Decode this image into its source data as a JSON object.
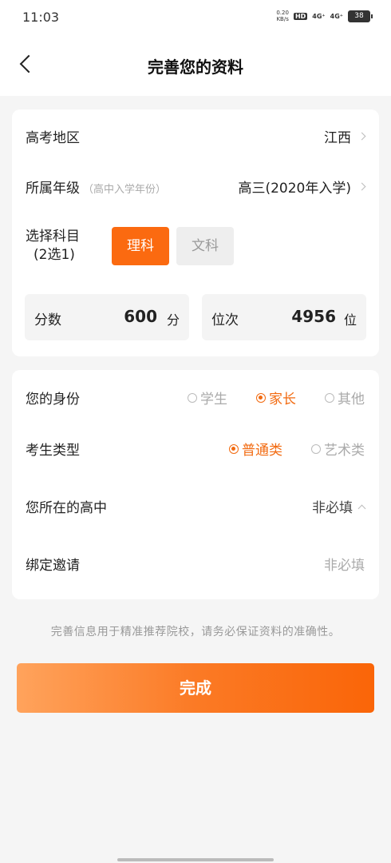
{
  "status_bar": {
    "time": "11:03",
    "net_speed_value": "0.20",
    "net_speed_unit": "KB/s",
    "hd": "HD",
    "signal1": "4G⁺",
    "signal2": "4G⁺",
    "battery": "38"
  },
  "header": {
    "title": "完善您的资料"
  },
  "card1": {
    "region": {
      "label": "高考地区",
      "value": "江西"
    },
    "grade": {
      "label": "所属年级",
      "sublabel": "（高中入学年份）",
      "value": "高三(2020年入学)"
    },
    "subject": {
      "label_line1": "选择科目",
      "label_line2": "(2选1)",
      "options": [
        "理科",
        "文科"
      ],
      "selected": "理科"
    },
    "score": {
      "label": "分数",
      "value": "600",
      "unit": "分"
    },
    "rank": {
      "label": "位次",
      "value": "4956",
      "unit": "位"
    }
  },
  "card2": {
    "identity": {
      "label": "您的身份",
      "options": [
        "学生",
        "家长",
        "其他"
      ],
      "selected": "家长"
    },
    "student_type": {
      "label": "考生类型",
      "options": [
        "普通类",
        "艺术类"
      ],
      "selected": "普通类"
    },
    "high_school": {
      "label": "您所在的高中",
      "placeholder": "非必填"
    },
    "invite": {
      "label": "绑定邀请",
      "placeholder": "非必填"
    }
  },
  "hint": "完善信息用于精准推荐院校，请务必保证资料的准确性。",
  "submit": {
    "label": "完成"
  },
  "colors": {
    "accent": "#fb6a10",
    "background": "#f5f5f5"
  }
}
